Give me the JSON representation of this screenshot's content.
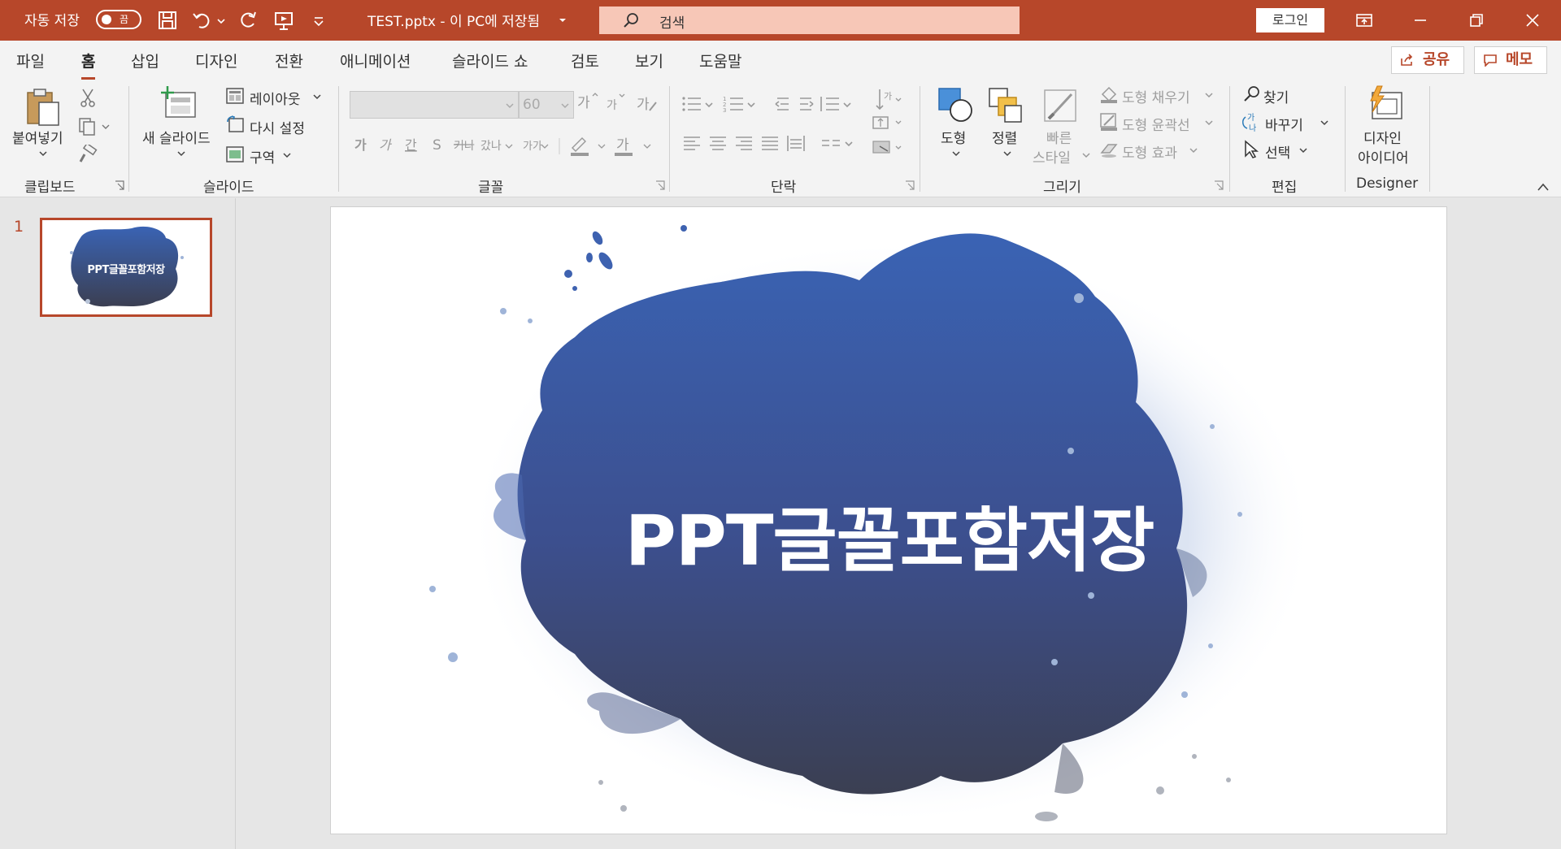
{
  "titlebar": {
    "autosave_label": "자동 저장",
    "autosave_state": "끔",
    "document": "TEST.pptx  -  이 PC에 저장됨",
    "search_placeholder": "검색",
    "login_label": "로그인"
  },
  "tabs": [
    "파일",
    "홈",
    "삽입",
    "디자인",
    "전환",
    "애니메이션",
    "슬라이드 쇼",
    "검토",
    "보기",
    "도움말"
  ],
  "active_tab": "홈",
  "share_label": "공유",
  "memo_label": "메모",
  "ribbon": {
    "clipboard": {
      "paste": "붙여넣기",
      "group": "클립보드"
    },
    "slides": {
      "new_slide": "새 슬라이드",
      "layout": "레이아웃",
      "reset": "다시 설정",
      "section": "구역",
      "group": "슬라이드"
    },
    "font": {
      "size": "60",
      "group": "글꼴"
    },
    "paragraph": {
      "group": "단락"
    },
    "drawing": {
      "shapes": "도형",
      "arrange": "정렬",
      "quick_styles_1": "빠른",
      "quick_styles_2": "스타일",
      "shape_fill": "도형 채우기",
      "shape_outline": "도형 윤곽선",
      "shape_effects": "도형 효과",
      "group": "그리기"
    },
    "editing": {
      "find": "찾기",
      "replace": "바꾸기",
      "select": "선택",
      "group": "편집"
    },
    "designer": {
      "idea_1": "디자인",
      "idea_2": "아이디어",
      "group": "Designer"
    }
  },
  "slides_pane": {
    "slide_number": "1",
    "thumb_title": "PPT글꼴포함저장"
  },
  "slide": {
    "title": "PPT글꼴포함저장"
  },
  "colors": {
    "accent": "#b7472a",
    "blob_top": "#3a63b4",
    "blob_bottom": "#3b3f52"
  }
}
